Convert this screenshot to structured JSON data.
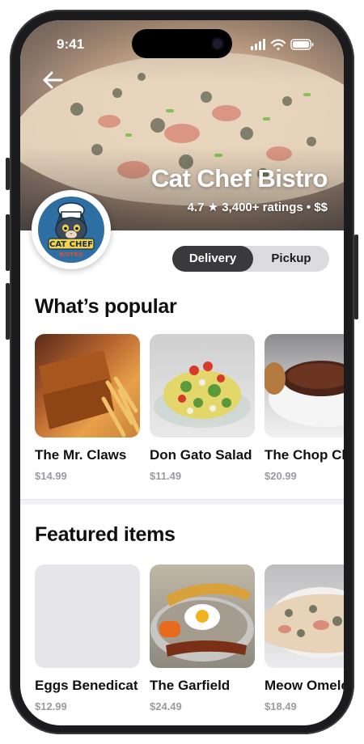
{
  "status_bar": {
    "time": "9:41"
  },
  "header": {
    "restaurant_name": "Cat Chef Bistro",
    "rating": "4.7",
    "rating_star": "★",
    "ratings_count": "3,400+ ratings",
    "separator": "•",
    "price_level": "$$",
    "back_icon": "arrow-left-icon"
  },
  "logo": {
    "line1": "CAT CHEF",
    "line2": "BISTRO"
  },
  "mode_toggle": {
    "options": [
      "Delivery",
      "Pickup"
    ],
    "selected": "Delivery"
  },
  "sections": [
    {
      "title": "What’s popular",
      "items": [
        {
          "name": "The Mr. Claws",
          "price": "$14.99"
        },
        {
          "name": "Don Gato Salad",
          "price": "$11.49"
        },
        {
          "name": "The Chop Ch",
          "price": "$20.99"
        }
      ]
    },
    {
      "title": "Featured items",
      "items": [
        {
          "name": "Eggs Benedicat",
          "price": "$12.99"
        },
        {
          "name": "The Garfield",
          "price": "$24.49"
        },
        {
          "name": "Meow Omele",
          "price": "$18.49"
        }
      ]
    }
  ]
}
